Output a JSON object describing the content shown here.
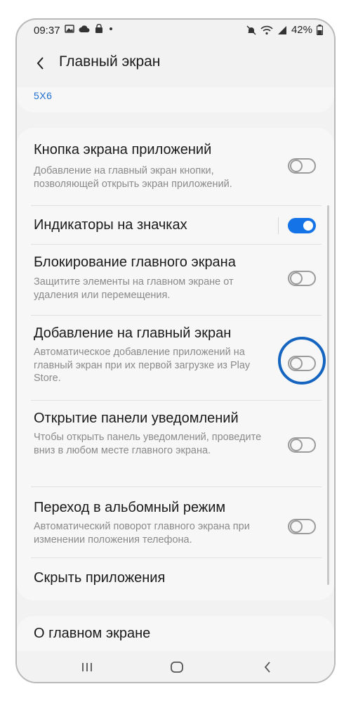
{
  "status_bar": {
    "time": "09:37",
    "battery": "42%",
    "left_icons": [
      "image-icon",
      "cloud-icon",
      "bag-icon",
      "dot-icon"
    ],
    "right_icons": [
      "mute-icon",
      "wifi-icon",
      "signal-icon",
      "battery-icon"
    ]
  },
  "header": {
    "title": "Главный экран"
  },
  "grid_setting": {
    "value": "5X6"
  },
  "settings": [
    {
      "title": "Кнопка экрана приложений",
      "desc": "Добавление на главный экран кнопки, позволяющей открыть экран приложений.",
      "state": "off"
    },
    {
      "title": "Индикаторы на значках",
      "desc": "",
      "state": "on"
    },
    {
      "title": "Блокирование главного экрана",
      "desc": "Защитите элементы на главном экране от удаления или перемещения.",
      "state": "off"
    },
    {
      "title": "Добавление на главный экран",
      "desc": "Автоматическое добавление приложений на главный экран при их первой загрузке из Play Store.",
      "state": "off"
    },
    {
      "title": "Открытие панели уведомлений",
      "desc": "Чтобы открыть панель уведомлений, проведите вниз в любом месте главного экрана.",
      "state": "off"
    },
    {
      "title": "Переход в альбомный режим",
      "desc": "Автоматический поворот главного экрана при изменении положения телефона.",
      "state": "off"
    },
    {
      "title": "Скрыть приложения",
      "desc": ""
    }
  ],
  "about": {
    "title": "О главном экране"
  },
  "colors": {
    "accent": "#1473e6",
    "highlight_ring": "#1565c0",
    "link": "#1f6fcf"
  },
  "nav_bar": {
    "icons": [
      "recents-icon",
      "home-icon",
      "back-icon"
    ]
  }
}
